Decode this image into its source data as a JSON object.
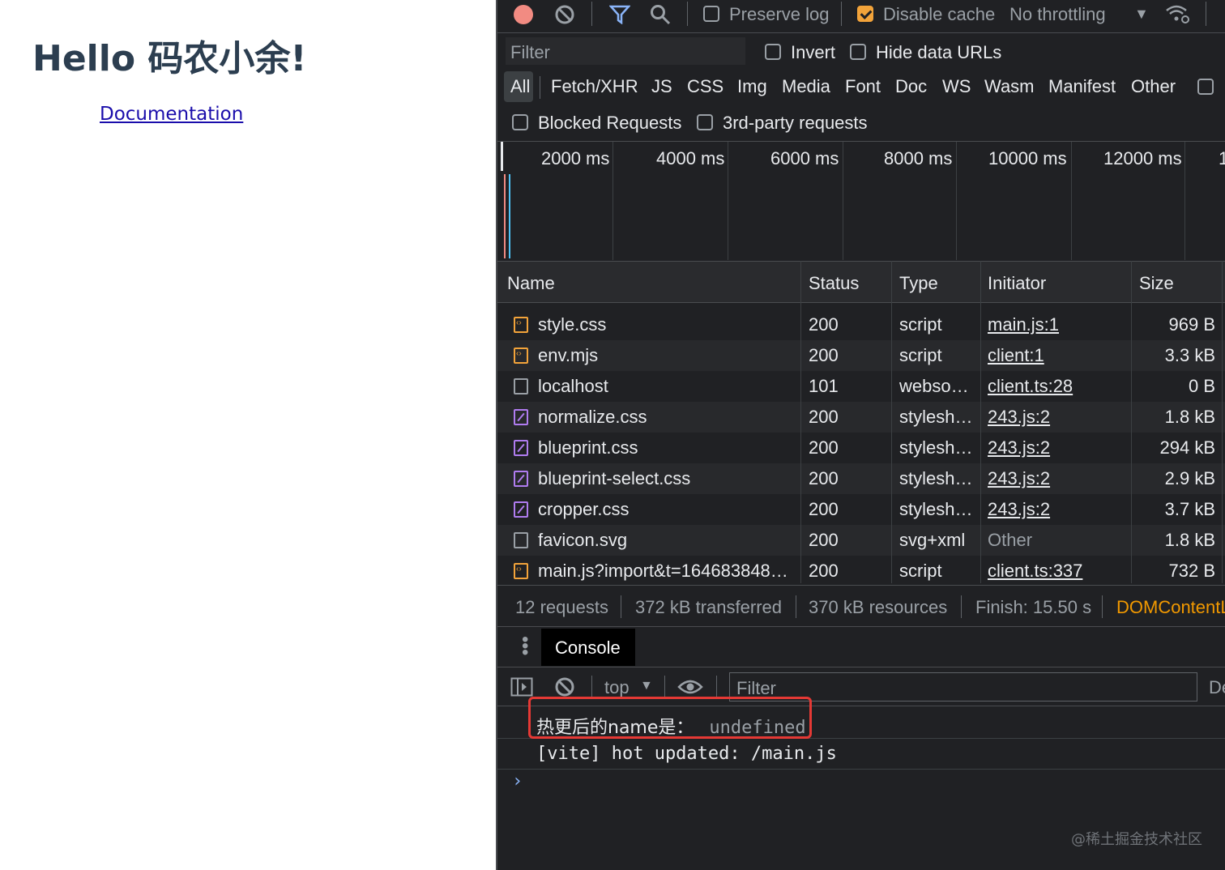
{
  "page": {
    "heading": "Hello 码农小余!",
    "link": "Documentation"
  },
  "toolbar": {
    "preserve_log": "Preserve log",
    "disable_cache": "Disable cache",
    "throttling": "No throttling",
    "throttle_arrow": "▼"
  },
  "filter": {
    "placeholder": "Filter",
    "invert": "Invert",
    "hide_data_urls": "Hide data URLs"
  },
  "types": [
    "All",
    "Fetch/XHR",
    "JS",
    "CSS",
    "Img",
    "Media",
    "Font",
    "Doc",
    "WS",
    "Wasm",
    "Manifest",
    "Other"
  ],
  "options": {
    "blocked": "Blocked Requests",
    "third_party": "3rd-party requests"
  },
  "timeline": {
    "labels": [
      "2000 ms",
      "4000 ms",
      "6000 ms",
      "8000 ms",
      "10000 ms",
      "12000 ms",
      "1"
    ]
  },
  "table": {
    "headers": [
      "Name",
      "Status",
      "Type",
      "Initiator",
      "Size"
    ],
    "rows": [
      {
        "name": "style.css",
        "status": "200",
        "type": "script",
        "initiator": "main.js:1",
        "size": "969 B",
        "icon": "script"
      },
      {
        "name": "env.mjs",
        "status": "200",
        "type": "script",
        "initiator": "client:1",
        "size": "3.3 kB",
        "icon": "script"
      },
      {
        "name": "localhost",
        "status": "101",
        "type": "webso…",
        "initiator": "client.ts:28",
        "size": "0 B",
        "icon": "plain"
      },
      {
        "name": "normalize.css",
        "status": "200",
        "type": "stylesh…",
        "initiator": "243.js:2",
        "size": "1.8 kB",
        "icon": "style"
      },
      {
        "name": "blueprint.css",
        "status": "200",
        "type": "stylesh…",
        "initiator": "243.js:2",
        "size": "294 kB",
        "icon": "style"
      },
      {
        "name": "blueprint-select.css",
        "status": "200",
        "type": "stylesh…",
        "initiator": "243.js:2",
        "size": "2.9 kB",
        "icon": "style"
      },
      {
        "name": "cropper.css",
        "status": "200",
        "type": "stylesh…",
        "initiator": "243.js:2",
        "size": "3.7 kB",
        "icon": "style"
      },
      {
        "name": "favicon.svg",
        "status": "200",
        "type": "svg+xml",
        "initiator": "Other",
        "size": "1.8 kB",
        "icon": "plain"
      },
      {
        "name": "main.js?import&t=164683848…",
        "status": "200",
        "type": "script",
        "initiator": "client.ts:337",
        "size": "732 B",
        "icon": "script"
      }
    ]
  },
  "statusbar": {
    "requests": "12 requests",
    "transferred": "372 kB transferred",
    "resources": "370 kB resources",
    "finish": "Finish: 15.50 s",
    "dom": "DOMContentL"
  },
  "drawer": {
    "tab": "Console"
  },
  "console": {
    "context": "top",
    "filter_placeholder": "Filter",
    "levels": "De",
    "log1_label": "热更后的name是：",
    "log1_value": "undefined",
    "log2": "[vite] hot updated: /main.js",
    "prompt": "›"
  },
  "watermark": "@稀土掘金技术社区"
}
